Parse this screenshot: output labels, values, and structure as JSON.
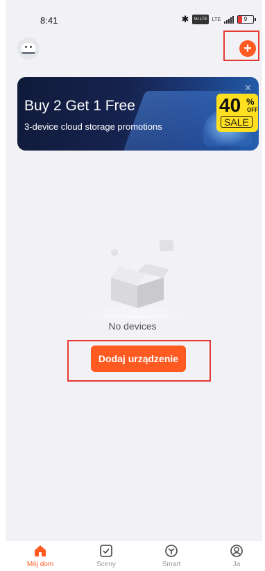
{
  "status_bar": {
    "time": "8:41",
    "bluetooth_icon": "bluetooth-icon",
    "volte_text": "Vo LTE",
    "network_text": "LTE",
    "battery_level": "9"
  },
  "header": {
    "avatar_icon": "robot-avatar-icon",
    "add_icon": "plus-icon"
  },
  "banner": {
    "title": "Buy 2 Get 1 Free",
    "subtitle": "3-device cloud storage promotions",
    "sale_percent": "40",
    "sale_percent_sign": "%",
    "sale_off": "OFF",
    "sale_text": "SALE",
    "close_symbol": "✕"
  },
  "empty_state": {
    "message": "No devices",
    "button_label": "Dodaj urządzenie"
  },
  "tabs": [
    {
      "label": "Mój dom",
      "icon": "home-icon",
      "active": true
    },
    {
      "label": "Sceny",
      "icon": "checkbox-icon",
      "active": false
    },
    {
      "label": "Smart",
      "icon": "smart-icon",
      "active": false
    },
    {
      "label": "Ja",
      "icon": "profile-icon",
      "active": false
    }
  ],
  "colors": {
    "accent": "#ff5a22",
    "highlight_border": "#e53935",
    "background": "#f2f2f6"
  }
}
